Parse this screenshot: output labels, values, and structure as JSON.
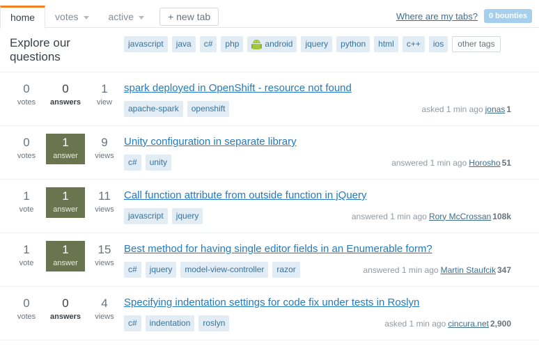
{
  "tabbar": {
    "tabs": [
      {
        "label": "home",
        "active": true,
        "has_caret": false
      },
      {
        "label": "votes",
        "active": false,
        "has_caret": true
      },
      {
        "label": "active",
        "active": false,
        "has_caret": true
      }
    ],
    "new_tab_label": "+ new tab",
    "mytabs_label": "Where are my tabs?",
    "bounty_label": "0 bounties",
    "accent_color": "#f48024",
    "bounty_bg": "#a6ceed"
  },
  "explore": {
    "title": "Explore our questions",
    "tags": [
      {
        "label": "javascript",
        "icon": null
      },
      {
        "label": "java",
        "icon": null
      },
      {
        "label": "c#",
        "icon": null
      },
      {
        "label": "php",
        "icon": null
      },
      {
        "label": "android",
        "icon": "android-icon"
      },
      {
        "label": "jquery",
        "icon": null
      },
      {
        "label": "python",
        "icon": null
      },
      {
        "label": "html",
        "icon": null
      },
      {
        "label": "c++",
        "icon": null
      },
      {
        "label": "ios",
        "icon": null
      }
    ],
    "other_tags_label": "other tags",
    "tag_bg": "#e1ecf4",
    "tag_color": "#39739d"
  },
  "questions": [
    {
      "votes": {
        "num": "0",
        "lbl": "votes"
      },
      "answers": {
        "num": "0",
        "lbl": "answers",
        "answered": false,
        "emph": true
      },
      "views": {
        "num": "1",
        "lbl": "view"
      },
      "title": "spark deployed in OpenShift - resource not found",
      "tags": [
        "apache-spark",
        "openshift"
      ],
      "action": "asked",
      "time": "1 min ago",
      "user": "jonas",
      "rep": "1"
    },
    {
      "votes": {
        "num": "0",
        "lbl": "votes"
      },
      "answers": {
        "num": "1",
        "lbl": "answer",
        "answered": true,
        "emph": false
      },
      "views": {
        "num": "9",
        "lbl": "views"
      },
      "title": "Unity configuration in separate library",
      "tags": [
        "c#",
        "unity"
      ],
      "action": "answered",
      "time": "1 min ago",
      "user": "Horosho",
      "rep": "51"
    },
    {
      "votes": {
        "num": "1",
        "lbl": "vote"
      },
      "answers": {
        "num": "1",
        "lbl": "answer",
        "answered": true,
        "emph": false
      },
      "views": {
        "num": "11",
        "lbl": "views"
      },
      "title": "Call function attribute from outside function in jQuery",
      "tags": [
        "javascript",
        "jquery"
      ],
      "action": "answered",
      "time": "1 min ago",
      "user": "Rory McCrossan",
      "rep": "108k"
    },
    {
      "votes": {
        "num": "1",
        "lbl": "vote"
      },
      "answers": {
        "num": "1",
        "lbl": "answer",
        "answered": true,
        "emph": false
      },
      "views": {
        "num": "15",
        "lbl": "views"
      },
      "title": "Best method for having single editor fields in an Enumerable form?",
      "tags": [
        "c#",
        "jquery",
        "model-view-controller",
        "razor"
      ],
      "action": "answered",
      "time": "1 min ago",
      "user": "Martin Staufcik",
      "rep": "347"
    },
    {
      "votes": {
        "num": "0",
        "lbl": "votes"
      },
      "answers": {
        "num": "0",
        "lbl": "answers",
        "answered": false,
        "emph": true
      },
      "views": {
        "num": "4",
        "lbl": "views"
      },
      "title": "Specifying indentation settings for code fix under tests in Roslyn",
      "tags": [
        "c#",
        "indentation",
        "roslyn"
      ],
      "action": "asked",
      "time": "1 min ago",
      "user": "cincura.net",
      "rep": "2,900"
    }
  ]
}
